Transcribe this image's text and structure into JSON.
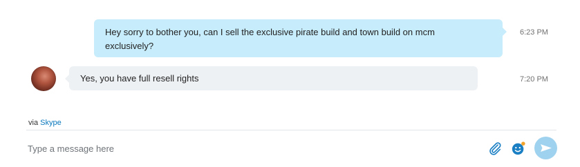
{
  "conversation": {
    "messages": [
      {
        "direction": "outgoing",
        "text": "Hey sorry to bother you, can I sell the exclusive pirate build and town build on mcm exclusively?",
        "time": "6:23 PM"
      },
      {
        "direction": "incoming",
        "text": "Yes, you have full resell rights",
        "time": "7:20 PM",
        "avatar_icon": "user-avatar"
      }
    ]
  },
  "via": {
    "prefix": "via",
    "link": "Skype"
  },
  "composer": {
    "placeholder": "Type a message here",
    "value": "",
    "icons": [
      "paperclip-icon",
      "emoji-icon",
      "send-icon"
    ]
  },
  "colors": {
    "outgoing_bubble": "#c7ecfb",
    "incoming_bubble": "#eef1f4",
    "link": "#0a78bd",
    "icon_blue": "#1b7fc4",
    "send_button": "#9fd2ee",
    "notification_dot": "#f2a32c"
  }
}
